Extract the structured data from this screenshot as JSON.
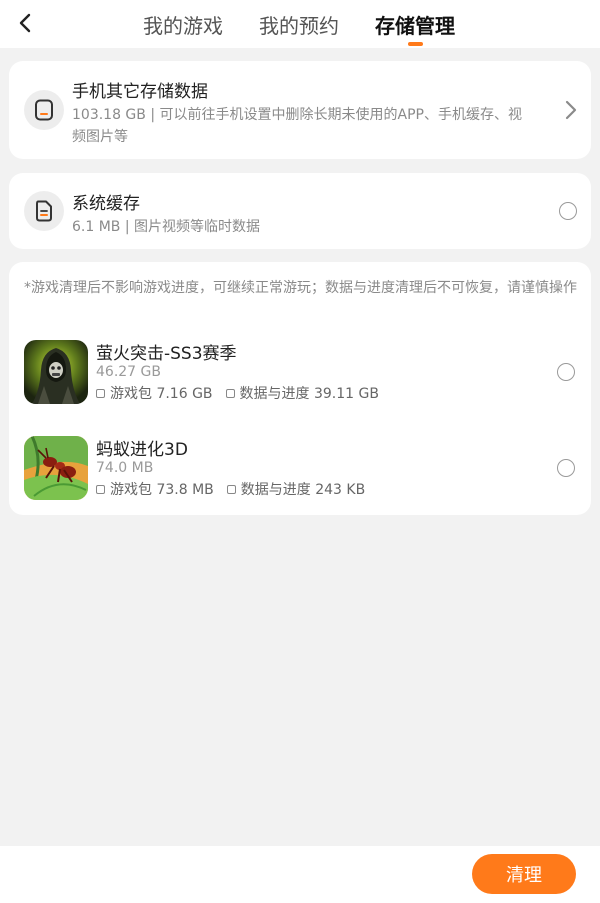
{
  "header": {
    "back_icon": "chevron-left-icon",
    "tabs": [
      {
        "label": "我的游戏"
      },
      {
        "label": "我的预约"
      },
      {
        "label": "存储管理"
      }
    ],
    "active_tab_index": 2,
    "accent_color": "#ff7a1a"
  },
  "other_storage": {
    "title": "手机其它存储数据",
    "description": "103.18 GB | 可以前往手机设置中删除长期未使用的APP、手机缓存、视频图片等",
    "icon": "phone-icon"
  },
  "system_cache": {
    "title": "系统缓存",
    "description": "6.1 MB | 图片视频等临时数据",
    "icon": "document-icon"
  },
  "games_section": {
    "note": "*游戏清理后不影响游戏进度，可继续正常游玩；数据与进度清理后不可恢复，请谨慎操作",
    "games": [
      {
        "name": "萤火突击-SS3赛季",
        "size": "46.27 GB",
        "package_label": "游戏包 7.16 GB",
        "data_label": "数据与进度 39.11 GB"
      },
      {
        "name": "蚂蚁进化3D",
        "size": "74.0 MB",
        "package_label": "游戏包 73.8 MB",
        "data_label": "数据与进度 243 KB"
      }
    ]
  },
  "footer": {
    "clean_label": "清理"
  }
}
